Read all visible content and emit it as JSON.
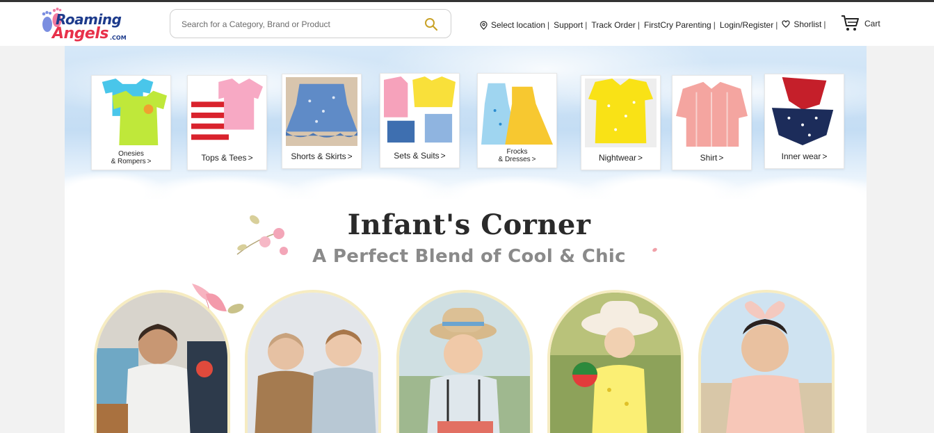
{
  "site": {
    "logo_line1": "Roaming",
    "logo_line2": "Angels",
    "logo_suffix": ".COM"
  },
  "search": {
    "placeholder": "Search for a Category, Brand or Product",
    "value": ""
  },
  "nav": {
    "items": [
      {
        "label": "Select location",
        "icon": "location-pin-icon"
      },
      {
        "label": "Support"
      },
      {
        "label": "Track Order"
      },
      {
        "label": "FirstCry Parenting"
      },
      {
        "label": "Login/Register"
      },
      {
        "label": "Shorlist",
        "icon": "heart-icon"
      }
    ],
    "separator": "|",
    "cart_label": "Cart"
  },
  "categories": [
    {
      "line1": "Onesies",
      "line2": "& Rompers",
      "arrow": ">"
    },
    {
      "line1": "Tops & Tees",
      "arrow": ">"
    },
    {
      "line1": "Shorts & Skirts",
      "arrow": ">"
    },
    {
      "line1": "Sets & Suits",
      "arrow": ">"
    },
    {
      "line1": "Frocks",
      "line2": "& Dresses",
      "arrow": ">"
    },
    {
      "line1": "Nightwear",
      "arrow": ">"
    },
    {
      "line1": "Shirt",
      "arrow": ">"
    },
    {
      "line1": "Inner wear",
      "arrow": ">"
    }
  ],
  "section": {
    "title": "Infant's Corner",
    "subtitle": "A Perfect Blend of Cool & Chic"
  },
  "colors": {
    "brand_blue": "#1d3b8c",
    "brand_pink": "#e8314a",
    "search_icon": "#c9a227",
    "arch_border": "#f6ecc2"
  }
}
